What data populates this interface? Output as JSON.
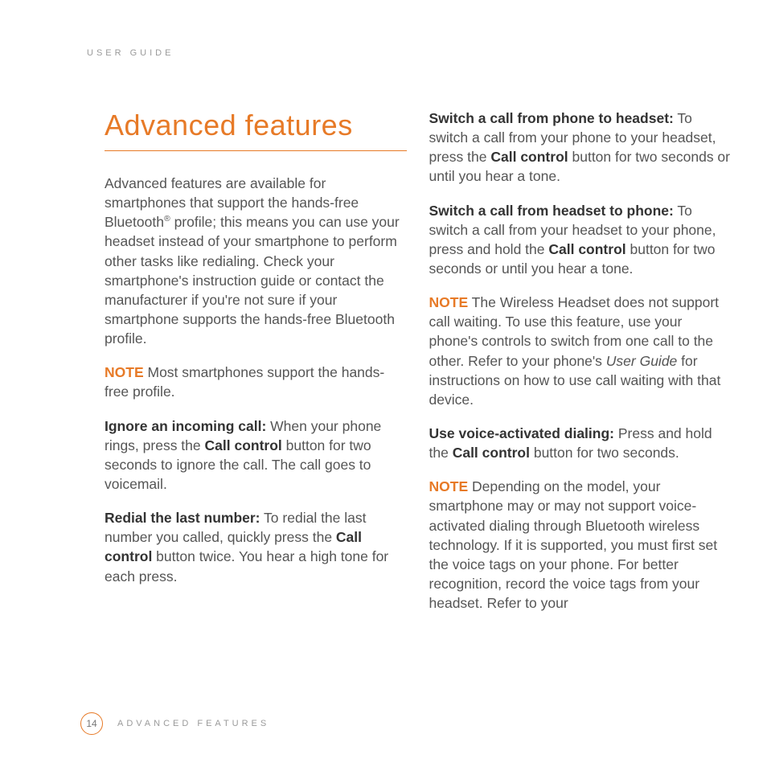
{
  "header": {
    "label": "USER GUIDE"
  },
  "title": "Advanced features",
  "left": {
    "intro_a": "Advanced features are available for smartphones that support the hands-free Bluetooth",
    "reg": "®",
    "intro_b": " profile; this means you can use your headset instead of your smartphone to perform other tasks like redialing. Check your smartphone's instruction guide or contact the manufacturer if you're not sure if your smartphone supports the hands-free Bluetooth profile.",
    "note1_label": "NOTE",
    "note1_text": "  Most smartphones support the hands-free profile.",
    "ignore_label": "Ignore an incoming call:",
    "ignore_a": "  When your phone rings, press the ",
    "ignore_cc": "Call control",
    "ignore_b": " button for two seconds to ignore the call. The call goes to voicemail.",
    "redial_label": "Redial the last number:",
    "redial_a": "  To redial the last number you called, quickly press the ",
    "redial_cc": "Call control",
    "redial_b": " button twice. You hear a high tone for each press."
  },
  "right": {
    "sw_ph_label": "Switch a call from phone to headset:",
    "sw_ph_a": "  To switch a call from your phone to your headset, press the ",
    "sw_ph_cc": "Call control",
    "sw_ph_b": " button for two seconds or until you hear a tone.",
    "sw_hs_label": "Switch a call from headset to phone:",
    "sw_hs_a": "  To switch a call from your headset to your phone, press and hold the ",
    "sw_hs_cc": "Call control",
    "sw_hs_b": " button for two seconds or until you hear a tone.",
    "note2_label": "NOTE",
    "note2_a": "  The Wireless Headset does not support call waiting. To use this feature, use your phone's controls to switch from one call to the other. Refer to your phone's ",
    "note2_ital": "User Guide",
    "note2_b": " for instructions on how to use call waiting with that device.",
    "voice_label": "Use voice-activated dialing:",
    "voice_a": "  Press and hold the ",
    "voice_cc": "Call control",
    "voice_b": " button for two seconds.",
    "note3_label": "NOTE",
    "note3_text": "  Depending on the model, your smartphone may or may not support voice-activated dialing through Bluetooth wireless technology. If it is supported, you must first set the voice tags on your phone. For better recognition, record the voice tags from your headset. Refer to your"
  },
  "footer": {
    "page": "14",
    "section": "ADVANCED FEATURES"
  }
}
